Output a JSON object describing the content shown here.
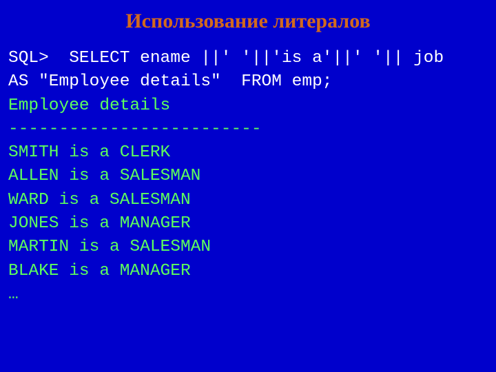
{
  "title": "Использование литералов",
  "sql_prompt": "SQL>  SELECT ename ||' '||'is a'||' '|| job     AS \"Employee details\"  FROM emp;",
  "output": {
    "header": "Employee details",
    "separator": "-------------------------",
    "rows": [
      "SMITH is a CLERK",
      "ALLEN is a SALESMAN",
      "WARD is a SALESMAN",
      "JONES is a MANAGER",
      "MARTIN is a SALESMAN",
      "BLAKE is a MANAGER",
      "…"
    ]
  }
}
